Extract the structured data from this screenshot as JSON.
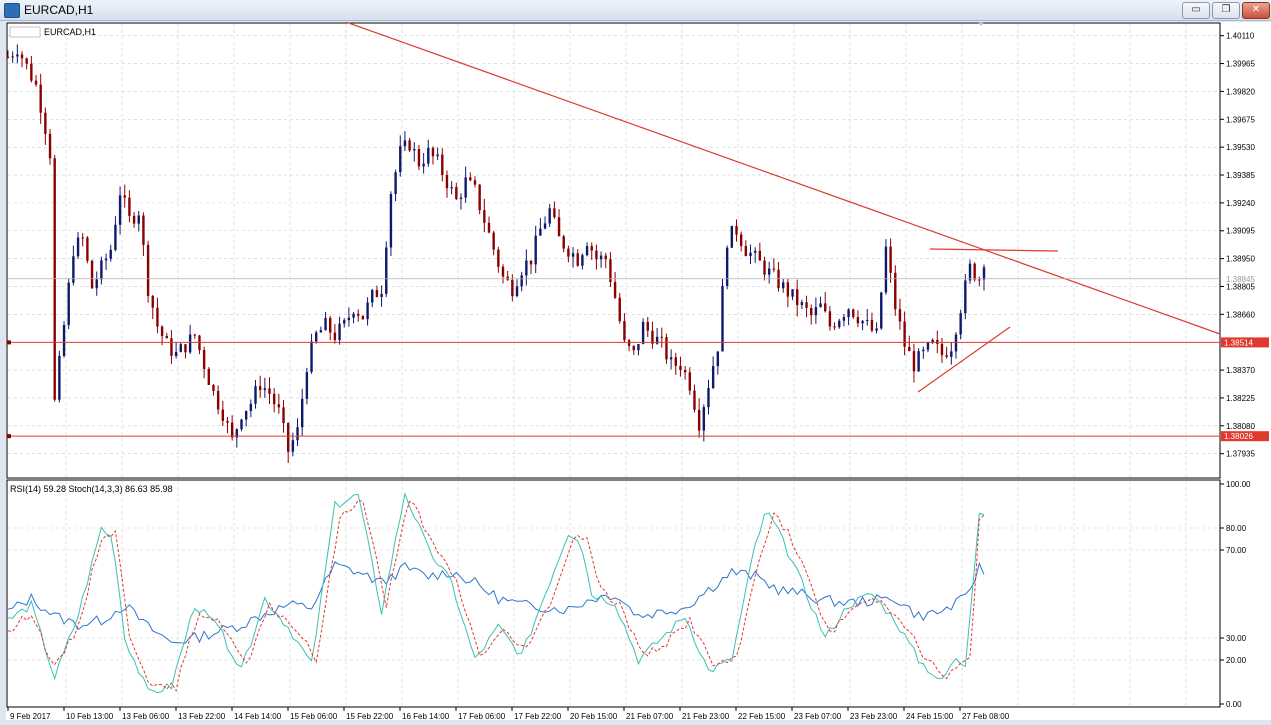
{
  "window": {
    "title": "EURCAD,H1",
    "chart_label": "EURCAD,H1",
    "minimize_glyph": "▭",
    "restore_glyph": "❐",
    "close_glyph": "✕"
  },
  "indicator_label": "RSI(14) 59.28 Stoch(14,3,3) 86.63 85.98",
  "colors": {
    "bull": "#101a6b",
    "bear": "#8b0000",
    "line": "#e03a2f",
    "rsi": "#2f74d0",
    "stoch_main": "#3cc0b5",
    "stoch_signal": "#e03a2f",
    "grid": "#c9ced6"
  },
  "chart_data": [
    {
      "type": "candlestick",
      "symbol": "EURCAD",
      "timeframe": "H1",
      "y_ticks": [
        "1.40110",
        "1.39965",
        "1.39820",
        "1.39675",
        "1.39530",
        "1.39385",
        "1.39240",
        "1.39095",
        "1.38950",
        "1.38805",
        "1.38660",
        "1.38370",
        "1.38225",
        "1.38080",
        "1.37935"
      ],
      "ylim": [
        1.3785,
        1.4015
      ],
      "current_price_label": "1.38845",
      "current_price": 1.38845,
      "horizontal_levels": [
        {
          "value": 1.38514,
          "label": "1.38514"
        },
        {
          "value": 1.38026,
          "label": "1.38026"
        }
      ],
      "x_ticks": [
        "9 Feb 2017",
        "10 Feb 13:00",
        "13 Feb 06:00",
        "13 Feb 22:00",
        "14 Feb 14:00",
        "15 Feb 06:00",
        "15 Feb 22:00",
        "16 Feb 14:00",
        "17 Feb 06:00",
        "17 Feb 22:00",
        "20 Feb 15:00",
        "21 Feb 07:00",
        "21 Feb 23:00",
        "22 Feb 15:00",
        "23 Feb 07:00",
        "23 Feb 23:00",
        "24 Feb 15:00",
        "27 Feb 08:00"
      ],
      "close_path": [
        [
          0,
          1.4
        ],
        [
          4,
          1.4005
        ],
        [
          8,
          1.3995
        ],
        [
          12,
          1.3985
        ],
        [
          15,
          1.397
        ],
        [
          18,
          1.395
        ],
        [
          20,
          1.382
        ],
        [
          24,
          1.386
        ],
        [
          28,
          1.39
        ],
        [
          32,
          1.3905
        ],
        [
          36,
          1.388
        ],
        [
          40,
          1.389
        ],
        [
          44,
          1.39
        ],
        [
          48,
          1.393
        ],
        [
          52,
          1.3915
        ],
        [
          56,
          1.392
        ],
        [
          60,
          1.388
        ],
        [
          64,
          1.386
        ],
        [
          68,
          1.385
        ],
        [
          72,
          1.3845
        ],
        [
          76,
          1.385
        ],
        [
          80,
          1.3855
        ],
        [
          84,
          1.384
        ],
        [
          88,
          1.3825
        ],
        [
          92,
          1.3815
        ],
        [
          96,
          1.38
        ],
        [
          100,
          1.3815
        ],
        [
          104,
          1.382
        ],
        [
          108,
          1.383
        ],
        [
          112,
          1.3825
        ],
        [
          116,
          1.3815
        ],
        [
          120,
          1.3795
        ],
        [
          124,
          1.3805
        ],
        [
          128,
          1.384
        ],
        [
          132,
          1.3855
        ],
        [
          136,
          1.386
        ],
        [
          140,
          1.3855
        ],
        [
          144,
          1.386
        ],
        [
          148,
          1.387
        ],
        [
          152,
          1.3865
        ],
        [
          156,
          1.3875
        ],
        [
          160,
          1.388
        ],
        [
          164,
          1.393
        ],
        [
          168,
          1.395
        ],
        [
          172,
          1.3955
        ],
        [
          176,
          1.3945
        ],
        [
          180,
          1.395
        ],
        [
          184,
          1.3945
        ],
        [
          188,
          1.3935
        ],
        [
          192,
          1.3925
        ],
        [
          196,
          1.3935
        ],
        [
          200,
          1.393
        ],
        [
          204,
          1.3915
        ],
        [
          208,
          1.39
        ],
        [
          212,
          1.3885
        ],
        [
          216,
          1.388
        ],
        [
          220,
          1.389
        ],
        [
          224,
          1.3895
        ],
        [
          228,
          1.391
        ],
        [
          232,
          1.392
        ],
        [
          236,
          1.3905
        ],
        [
          240,
          1.39
        ],
        [
          244,
          1.3895
        ],
        [
          248,
          1.3905
        ],
        [
          252,
          1.3895
        ],
        [
          256,
          1.3895
        ],
        [
          260,
          1.3875
        ],
        [
          264,
          1.385
        ],
        [
          268,
          1.3845
        ],
        [
          272,
          1.386
        ],
        [
          276,
          1.3855
        ],
        [
          280,
          1.385
        ],
        [
          284,
          1.384
        ],
        [
          288,
          1.384
        ],
        [
          292,
          1.383
        ],
        [
          296,
          1.381
        ],
        [
          300,
          1.383
        ],
        [
          304,
          1.385
        ],
        [
          308,
          1.3905
        ],
        [
          312,
          1.391
        ],
        [
          316,
          1.39
        ],
        [
          320,
          1.3895
        ],
        [
          324,
          1.389
        ],
        [
          328,
          1.3885
        ],
        [
          332,
          1.388
        ],
        [
          336,
          1.3875
        ],
        [
          340,
          1.387
        ],
        [
          344,
          1.3865
        ],
        [
          348,
          1.387
        ],
        [
          352,
          1.386
        ],
        [
          356,
          1.3865
        ],
        [
          360,
          1.387
        ],
        [
          364,
          1.3865
        ],
        [
          368,
          1.386
        ],
        [
          372,
          1.3855
        ],
        [
          376,
          1.39
        ],
        [
          380,
          1.387
        ],
        [
          384,
          1.385
        ],
        [
          388,
          1.384
        ],
        [
          392,
          1.3845
        ],
        [
          396,
          1.385
        ],
        [
          400,
          1.3845
        ],
        [
          404,
          1.385
        ],
        [
          408,
          1.387
        ],
        [
          412,
          1.389
        ],
        [
          416,
          1.3885
        ],
        [
          418,
          1.3895
        ]
      ]
    },
    {
      "type": "line",
      "panel": "indicator",
      "y_ticks": [
        "100.00",
        "80.00",
        "70.00",
        "30.00",
        "20.00",
        "0.00"
      ],
      "ylim": [
        0,
        100
      ],
      "series": [
        {
          "name": "RSI(14)",
          "last": 59.28,
          "values": [
            [
              0,
              42
            ],
            [
              10,
              48
            ],
            [
              20,
              40
            ],
            [
              30,
              36
            ],
            [
              40,
              38
            ],
            [
              50,
              45
            ],
            [
              60,
              35
            ],
            [
              70,
              28
            ],
            [
              80,
              30
            ],
            [
              90,
              33
            ],
            [
              100,
              36
            ],
            [
              110,
              41
            ],
            [
              120,
              45
            ],
            [
              130,
              44
            ],
            [
              140,
              63
            ],
            [
              150,
              60
            ],
            [
              160,
              55
            ],
            [
              170,
              62
            ],
            [
              180,
              58
            ],
            [
              190,
              60
            ],
            [
              200,
              55
            ],
            [
              210,
              48
            ],
            [
              220,
              45
            ],
            [
              230,
              44
            ],
            [
              240,
              43
            ],
            [
              250,
              48
            ],
            [
              260,
              50
            ],
            [
              270,
              40
            ],
            [
              280,
              42
            ],
            [
              290,
              44
            ],
            [
              300,
              52
            ],
            [
              310,
              60
            ],
            [
              320,
              58
            ],
            [
              330,
              52
            ],
            [
              340,
              50
            ],
            [
              350,
              47
            ],
            [
              360,
              46
            ],
            [
              370,
              47
            ],
            [
              380,
              48
            ],
            [
              390,
              40
            ],
            [
              400,
              42
            ],
            [
              410,
              48
            ],
            [
              416,
              62
            ],
            [
              418,
              60
            ]
          ]
        },
        {
          "name": "Stoch(14,3,3)",
          "last": 86.63,
          "values": [
            [
              0,
              38
            ],
            [
              10,
              45
            ],
            [
              20,
              12
            ],
            [
              30,
              40
            ],
            [
              40,
              80
            ],
            [
              45,
              75
            ],
            [
              50,
              30
            ],
            [
              60,
              5
            ],
            [
              70,
              8
            ],
            [
              80,
              45
            ],
            [
              90,
              35
            ],
            [
              100,
              15
            ],
            [
              110,
              48
            ],
            [
              120,
              35
            ],
            [
              130,
              18
            ],
            [
              140,
              90
            ],
            [
              150,
              95
            ],
            [
              160,
              42
            ],
            [
              170,
              96
            ],
            [
              180,
              70
            ],
            [
              190,
              55
            ],
            [
              200,
              20
            ],
            [
              210,
              35
            ],
            [
              220,
              22
            ],
            [
              230,
              50
            ],
            [
              240,
              78
            ],
            [
              245,
              75
            ],
            [
              250,
              50
            ],
            [
              260,
              46
            ],
            [
              270,
              20
            ],
            [
              280,
              30
            ],
            [
              290,
              40
            ],
            [
              300,
              15
            ],
            [
              310,
              20
            ],
            [
              320,
              72
            ],
            [
              325,
              88
            ],
            [
              330,
              78
            ],
            [
              340,
              55
            ],
            [
              350,
              30
            ],
            [
              360,
              45
            ],
            [
              370,
              50
            ],
            [
              380,
              38
            ],
            [
              390,
              20
            ],
            [
              400,
              10
            ],
            [
              405,
              20
            ],
            [
              410,
              18
            ],
            [
              416,
              88
            ],
            [
              418,
              86.63
            ]
          ]
        },
        {
          "name": "Signal",
          "last": 85.98,
          "values": [
            [
              0,
              32
            ],
            [
              10,
              42
            ],
            [
              20,
              16
            ],
            [
              30,
              35
            ],
            [
              40,
              76
            ],
            [
              46,
              78
            ],
            [
              52,
              32
            ],
            [
              62,
              7
            ],
            [
              72,
              8
            ],
            [
              82,
              42
            ],
            [
              92,
              36
            ],
            [
              102,
              17
            ],
            [
              112,
              44
            ],
            [
              122,
              36
            ],
            [
              132,
              20
            ],
            [
              142,
              84
            ],
            [
              152,
              94
            ],
            [
              162,
              45
            ],
            [
              172,
              94
            ],
            [
              182,
              72
            ],
            [
              192,
              56
            ],
            [
              202,
              22
            ],
            [
              212,
              33
            ],
            [
              222,
              24
            ],
            [
              232,
              46
            ],
            [
              242,
              74
            ],
            [
              248,
              76
            ],
            [
              254,
              52
            ],
            [
              262,
              45
            ],
            [
              272,
              22
            ],
            [
              282,
              28
            ],
            [
              292,
              38
            ],
            [
              302,
              18
            ],
            [
              312,
              20
            ],
            [
              322,
              68
            ],
            [
              328,
              86
            ],
            [
              334,
              78
            ],
            [
              342,
              58
            ],
            [
              352,
              32
            ],
            [
              362,
              44
            ],
            [
              372,
              48
            ],
            [
              382,
              40
            ],
            [
              392,
              22
            ],
            [
              402,
              12
            ],
            [
              408,
              18
            ],
            [
              412,
              20
            ],
            [
              416,
              84
            ],
            [
              418,
              85.98
            ]
          ]
        }
      ]
    }
  ]
}
